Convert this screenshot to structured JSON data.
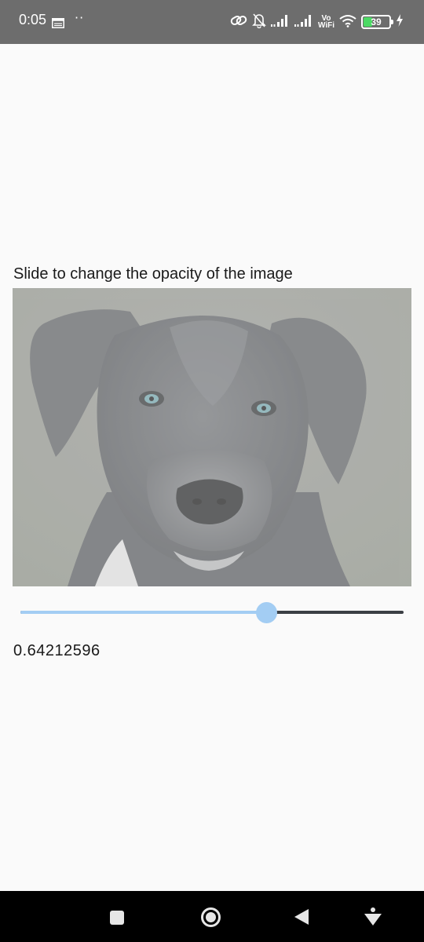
{
  "status_bar": {
    "time": "0:05",
    "dots": "··",
    "network_label_top": "Vo",
    "network_label_bottom": "WiFi",
    "battery_level": "39",
    "battery_fraction": 0.39,
    "colors": {
      "background": "#6d6d6d",
      "battery_fill": "#4cd964"
    },
    "icons": [
      "calendar-icon",
      "link-icon",
      "bell-off-icon",
      "signal-icon",
      "signal-icon",
      "wifi-icon",
      "battery-icon",
      "charging-icon"
    ]
  },
  "main": {
    "caption": "Slide to change the opacity of the image",
    "image": {
      "subject": "dog-photo",
      "opacity": 0.64212596
    },
    "slider": {
      "value": 0.64212596,
      "min": 0,
      "max": 1,
      "active_color": "#a3cdf3",
      "inactive_color": "#3b3f44"
    },
    "value_text": "0.64212596"
  },
  "nav_bar": {
    "buttons": [
      "recents-square-icon",
      "home-circle-icon",
      "back-triangle-icon",
      "assistant-icon"
    ]
  }
}
